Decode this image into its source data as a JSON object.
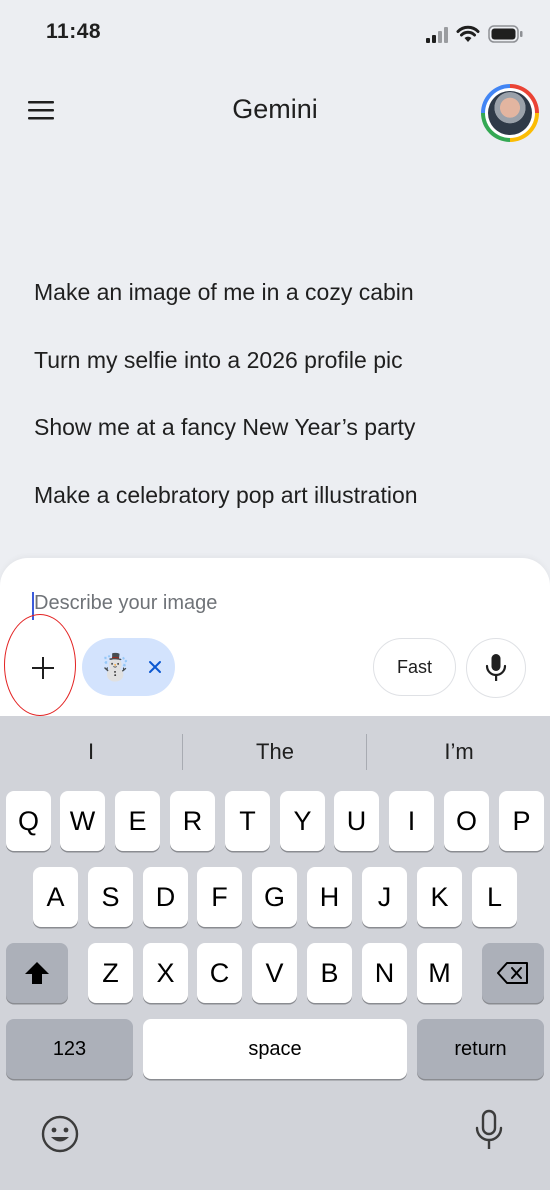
{
  "status_bar": {
    "time": "11:48"
  },
  "header": {
    "title": "Gemini",
    "menu_icon": "hamburger-icon",
    "avatar_icon": "profile-avatar"
  },
  "suggestions": [
    "Make an image of me in a cozy cabin",
    "Turn my selfie into a 2026 profile pic",
    "Show me at a fancy New Year’s party",
    "Make a celebratory pop art illustration"
  ],
  "composer": {
    "placeholder": "Describe your image",
    "chip_emoji": "☃️",
    "mode_label": "Fast",
    "accent_color": "#d3e3fd",
    "annotation_color": "#e32222"
  },
  "keyboard": {
    "predictions": [
      "I",
      "The",
      "I’m"
    ],
    "row1": [
      "Q",
      "W",
      "E",
      "R",
      "T",
      "Y",
      "U",
      "I",
      "O",
      "P"
    ],
    "row2": [
      "A",
      "S",
      "D",
      "F",
      "G",
      "H",
      "J",
      "K",
      "L"
    ],
    "row3": [
      "Z",
      "X",
      "C",
      "V",
      "B",
      "N",
      "M"
    ],
    "numbers_label": "123",
    "space_label": "space",
    "return_label": "return"
  }
}
